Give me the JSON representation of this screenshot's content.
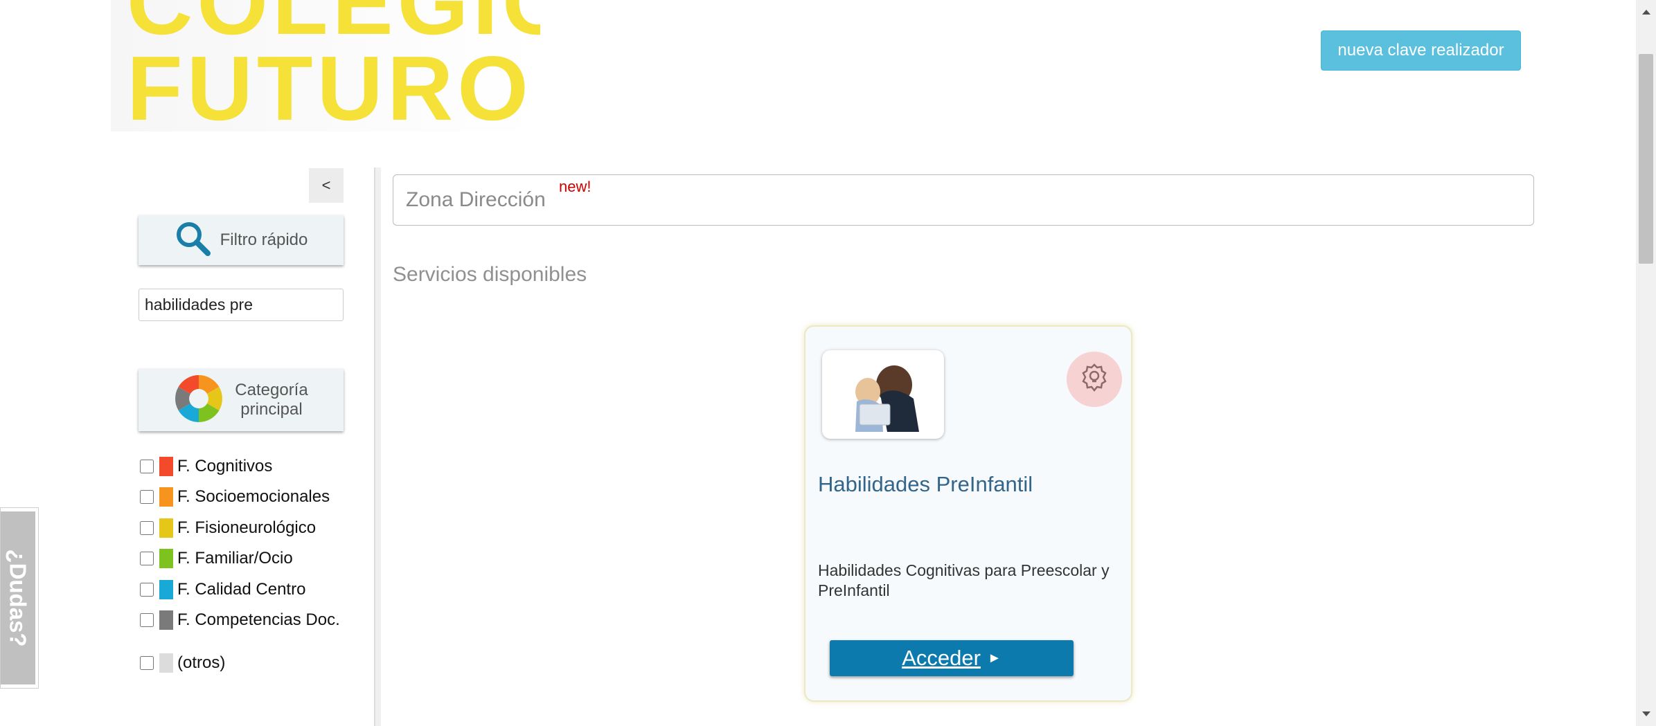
{
  "header": {
    "logo": {
      "line1": "COLEGIO",
      "line2": "FUTURO"
    },
    "clave_button": "nueva clave realizador"
  },
  "sidebar": {
    "collapse_label": "<",
    "quick_filter_label": "Filtro rápido",
    "search_value": "habilidades pre",
    "category_label_1": "Categoría",
    "category_label_2": "principal",
    "categories": [
      {
        "label": "F. Cognitivos",
        "color": "#f24a2a"
      },
      {
        "label": "F. Socioemocionales",
        "color": "#f7941d"
      },
      {
        "label": "F. Fisioneurológico",
        "color": "#e6c619"
      },
      {
        "label": "F. Familiar/Ocio",
        "color": "#7dc21e"
      },
      {
        "label": "F. Calidad Centro",
        "color": "#19a9d6"
      },
      {
        "label": "F. Competencias Doc.",
        "color": "#7a7a7a"
      },
      {
        "label": "(otros)",
        "color": "#dcdcdc"
      }
    ]
  },
  "main": {
    "zona_title": "Zona Dirección",
    "zona_badge": "new!",
    "section_title": "Servicios disponibles",
    "card": {
      "title": "Habilidades PreInfantil",
      "description": "Habilidades Cognitivas para Preescolar y PreInfantil",
      "access_label": "Acceder",
      "access_arrow": "►"
    }
  },
  "help_tab": "¿Dudas?"
}
